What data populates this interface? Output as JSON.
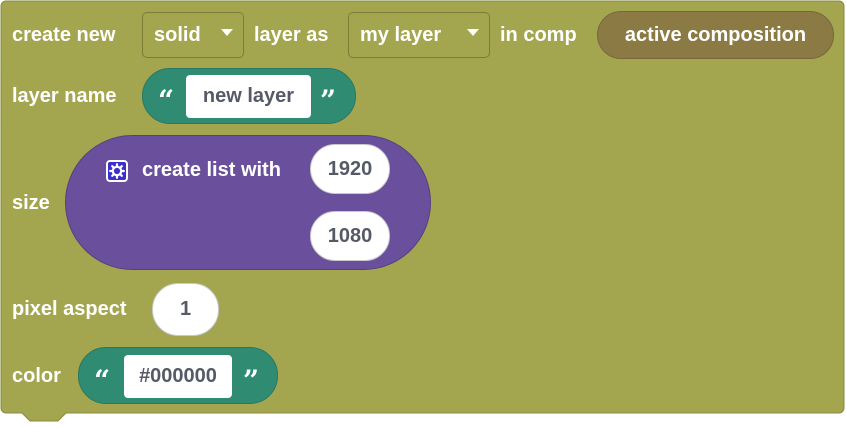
{
  "block": {
    "row1": {
      "create_new_label": "create new",
      "type_dropdown": "solid",
      "layer_as_label": "layer as",
      "layer_dropdown": "my layer",
      "in_comp_label": "in comp",
      "comp_variable": "active composition"
    },
    "layer_name": {
      "label": "layer name",
      "open_quote": "“",
      "value": "new layer",
      "close_quote": "”"
    },
    "size": {
      "label": "size",
      "list_label": "create list with",
      "values": [
        "1920",
        "1080"
      ]
    },
    "pixel_aspect": {
      "label": "pixel aspect",
      "value": "1"
    },
    "color": {
      "label": "color",
      "open_quote": "“",
      "value": "#000000",
      "close_quote": "”"
    }
  },
  "colors": {
    "block": "#a3a54f",
    "text_block": "#2f8c73",
    "list_block": "#6a4f9c",
    "variable": "#8b7a44",
    "mutator_icon": "#3b2fd0"
  },
  "icons": {
    "mutator": "gear-icon",
    "dropdown": "chevron-down-icon"
  }
}
